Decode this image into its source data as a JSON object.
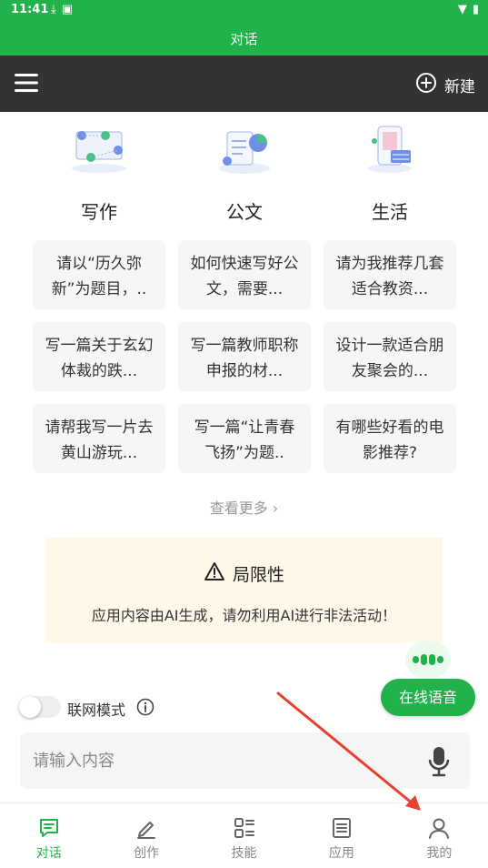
{
  "status": {
    "time": "11:41",
    "battery": "100"
  },
  "header": {
    "title": "对话"
  },
  "toolbar": {
    "new_label": "新建",
    "menu_icon": "menu-icon",
    "new_icon": "plus-circle-icon"
  },
  "categories": [
    {
      "label": "写作",
      "icon": "writing-illustration"
    },
    {
      "label": "公文",
      "icon": "document-illustration"
    },
    {
      "label": "生活",
      "icon": "life-illustration"
    }
  ],
  "cards": [
    [
      "请以“历久弥新”为题目，..",
      "写一篇关于玄幻体裁的跌...",
      "请帮我写一片去黄山游玩..."
    ],
    [
      "如何快速写好公文，需要...",
      "写一篇教师职称申报的材...",
      "写一篇“让青春飞扬”为题.."
    ],
    [
      "请为我推荐几套适合教资...",
      "设计一款适合朋友聚会的...",
      "有哪些好看的电影推荐?"
    ]
  ],
  "more_label": "查看更多",
  "notice": {
    "title": "局限性",
    "text": "应用内容由AI生成，请勿利用AI进行非法活动！"
  },
  "voice": {
    "label": "在线语音"
  },
  "network": {
    "label": "联网模式",
    "enabled": false
  },
  "input": {
    "placeholder": "请输入内容",
    "value": ""
  },
  "tabs": [
    {
      "label": "对话",
      "icon": "chat-icon",
      "active": true
    },
    {
      "label": "创作",
      "icon": "pencil-icon",
      "active": false
    },
    {
      "label": "技能",
      "icon": "skills-grid-icon",
      "active": false
    },
    {
      "label": "应用",
      "icon": "apps-list-icon",
      "active": false
    },
    {
      "label": "我的",
      "icon": "user-icon",
      "active": false
    }
  ],
  "colors": {
    "brand": "#22b24c",
    "toolbar": "#333333",
    "annotation_arrow": "#e8402f"
  }
}
